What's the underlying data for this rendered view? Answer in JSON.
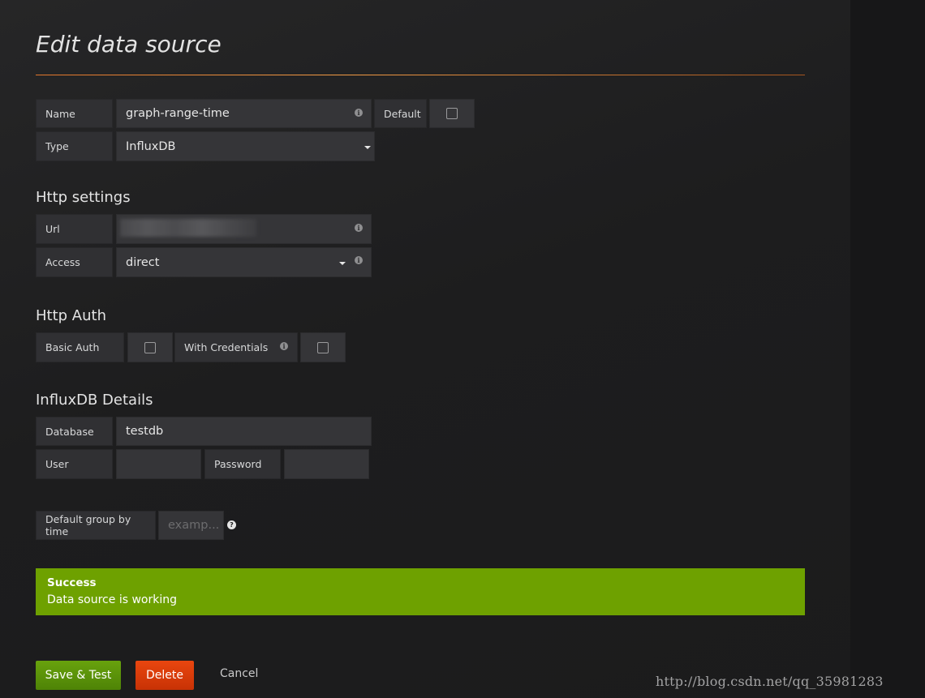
{
  "page": {
    "title": "Edit data source",
    "watermark": "http://blog.csdn.net/qq_35981283"
  },
  "general": {
    "name_label": "Name",
    "name_value": "graph-range-time",
    "default_label": "Default",
    "default_checked": false,
    "type_label": "Type",
    "type_value": "InfluxDB"
  },
  "http_settings": {
    "title": "Http settings",
    "url_label": "Url",
    "url_value": "",
    "access_label": "Access",
    "access_value": "direct"
  },
  "http_auth": {
    "title": "Http Auth",
    "basic_auth_label": "Basic Auth",
    "basic_auth_checked": false,
    "with_credentials_label": "With Credentials",
    "with_credentials_checked": false
  },
  "influxdb_details": {
    "title": "InfluxDB Details",
    "database_label": "Database",
    "database_value": "testdb",
    "user_label": "User",
    "user_value": "",
    "password_label": "Password",
    "password_value": ""
  },
  "group_by": {
    "label": "Default group by time",
    "placeholder": "examp..."
  },
  "alert": {
    "title": "Success",
    "message": "Data source is working",
    "color": "#6ea100"
  },
  "actions": {
    "save_label": "Save & Test",
    "delete_label": "Delete",
    "cancel_label": "Cancel"
  },
  "icons": {
    "info": "i",
    "help": "?"
  },
  "colors": {
    "accent_line": "#e2762c",
    "save_button": "#5a930a",
    "delete_button": "#e0420c"
  }
}
